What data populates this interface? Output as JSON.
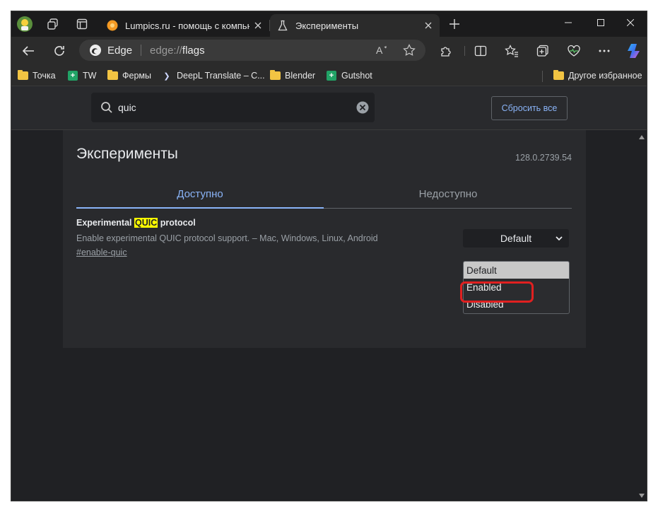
{
  "tabs": [
    {
      "title": "Lumpics.ru - помощь с компьюте",
      "favicon": "orange-icon",
      "active": false
    },
    {
      "title": "Эксперименты",
      "favicon": "flask-icon",
      "active": true
    }
  ],
  "window_controls": [
    "minimize-icon",
    "maximize-icon",
    "close-icon"
  ],
  "omnibox": {
    "browser_label": "Edge",
    "url_scheme": "edge://",
    "url_path": "flags"
  },
  "bookmarks": [
    {
      "label": "Точка",
      "icon": "folder-icon"
    },
    {
      "label": "TW",
      "icon": "sheet-icon"
    },
    {
      "label": "Фермы",
      "icon": "folder-icon"
    },
    {
      "label": "DeepL Translate – С...",
      "icon": "deepl-icon"
    },
    {
      "label": "Blender",
      "icon": "folder-icon"
    },
    {
      "label": "Gutshot",
      "icon": "sheet-icon"
    },
    {
      "label": "Другое избранное",
      "icon": "folder-icon"
    }
  ],
  "flags_header": {
    "search_value": "quic",
    "reset_label": "Сбросить все"
  },
  "page": {
    "title": "Эксперименты",
    "version": "128.0.2739.54",
    "tab_available": "Доступно",
    "tab_unavailable": "Недоступно"
  },
  "experiment": {
    "name_before": "Experimental ",
    "name_highlight": "QUIC",
    "name_after": " protocol",
    "description": "Enable experimental QUIC protocol support. – Mac, Windows, Linux, Android",
    "link": "#enable-quic",
    "selected": "Default",
    "options": [
      "Default",
      "Enabled",
      "Disabled"
    ],
    "highlighted_option": "Disabled"
  },
  "colors": {
    "accent": "#8ab4f8",
    "highlight_ring": "#e02020",
    "search_highlight": "#ffff00"
  }
}
